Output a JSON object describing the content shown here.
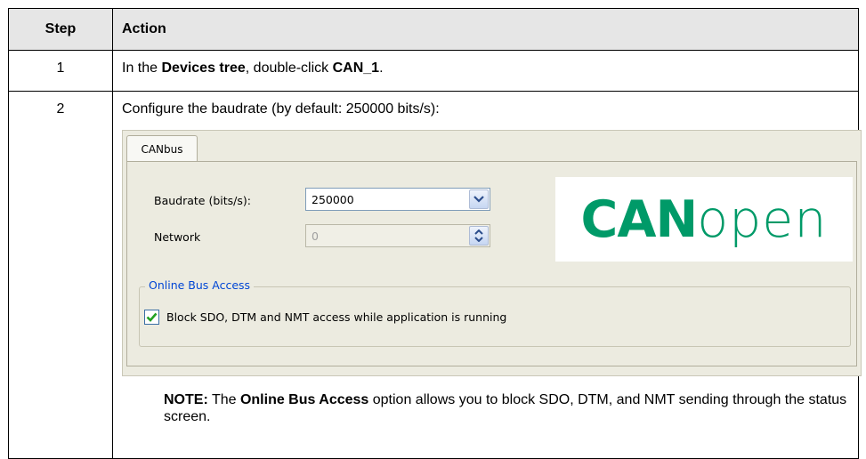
{
  "table": {
    "header_step": "Step",
    "header_action": "Action"
  },
  "row1": {
    "step": "1",
    "text_a": "In the ",
    "bold_a": "Devices tree",
    "text_b": ", double-click ",
    "bold_b": "CAN_1",
    "text_c": "."
  },
  "row2": {
    "step": "2",
    "intro": "Configure the baudrate (by default: 250000 bits/s):",
    "note_bold": "NOTE:",
    "note_text_a": " The ",
    "note_option": "Online Bus Access",
    "note_text_b": " option allows you to block SDO, DTM, and NMT sending through the status screen."
  },
  "dialog": {
    "tab_label": "CANbus",
    "baudrate_label": "Baudrate (bits/s):",
    "baudrate_value": "250000",
    "network_label": "Network",
    "network_value": "0",
    "group_title": "Online Bus Access",
    "checkbox_label": "Block SDO, DTM and NMT access while application is running",
    "checkbox_checked": true,
    "logo_bold": "CAN",
    "logo_light": "open",
    "logo_color": "#009a68"
  },
  "icons": {
    "dropdown": "chevron-down-icon",
    "spinner": "spinner-arrows-icon",
    "check": "checkmark-icon"
  }
}
